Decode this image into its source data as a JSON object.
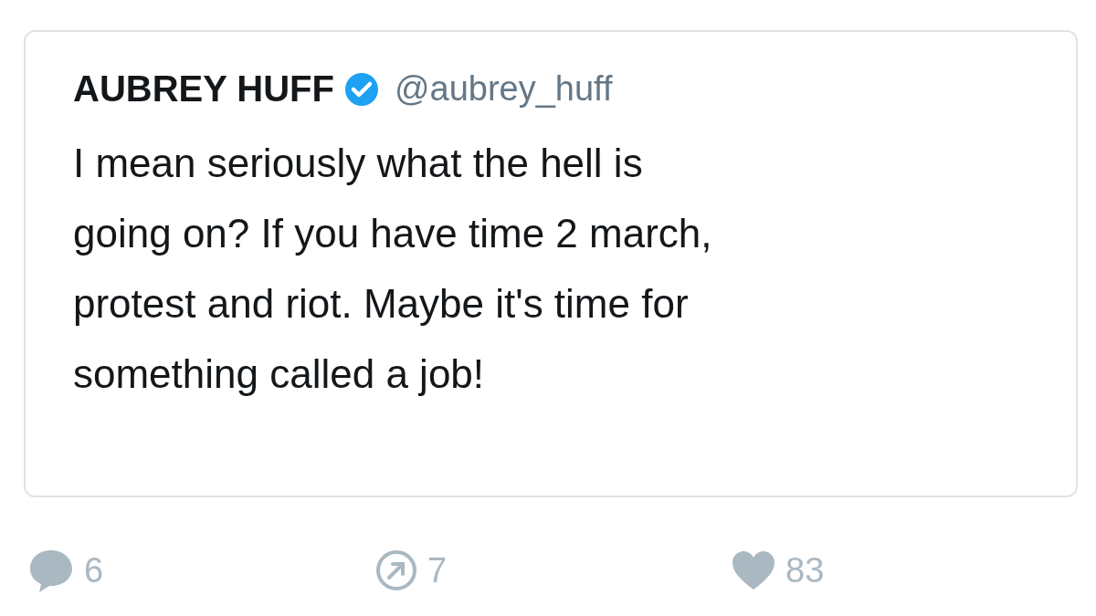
{
  "tweet": {
    "name": "AUBREY HUFF",
    "verified": true,
    "handle": "@aubrey_huff",
    "text": "I mean seriously what the hell is\ngoing on? If you have time 2 march,\nprotest and riot. Maybe it's time for\nsomething called a job!"
  },
  "actions": [
    {
      "kind": "reply",
      "count": "6"
    },
    {
      "kind": "quote",
      "count": "7"
    },
    {
      "kind": "like",
      "count": "83"
    }
  ]
}
